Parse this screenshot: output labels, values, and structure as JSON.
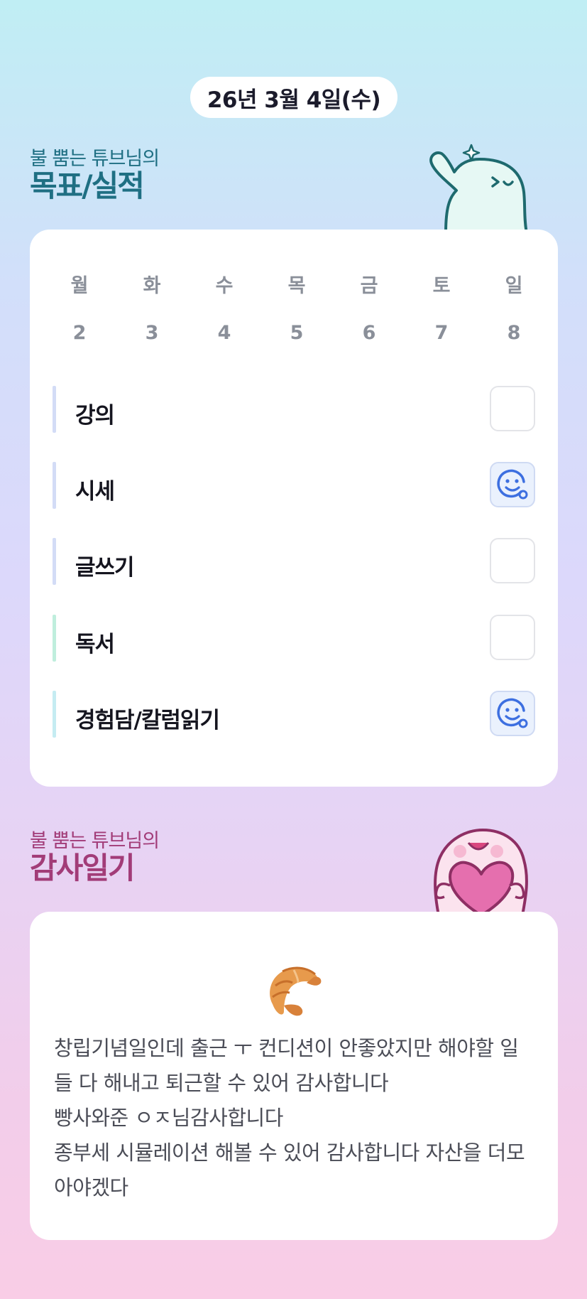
{
  "header": {
    "date": "26년 3월 4일(수)"
  },
  "goals": {
    "subtitle": "불 뿜는 튜브님의",
    "title": "목표/실적",
    "week_days": [
      "월",
      "화",
      "수",
      "목",
      "금",
      "토",
      "일"
    ],
    "week_dates": [
      "2",
      "3",
      "4",
      "5",
      "6",
      "7",
      "8"
    ],
    "items": [
      {
        "label": "강의",
        "done": false,
        "bar_color": "#d3dcf6"
      },
      {
        "label": "시세",
        "done": true,
        "bar_color": "#d3dcf6"
      },
      {
        "label": "글쓰기",
        "done": false,
        "bar_color": "#d3dcf6"
      },
      {
        "label": "독서",
        "done": false,
        "bar_color": "#bfeedd"
      },
      {
        "label": "경험담/칼럼읽기",
        "done": true,
        "bar_color": "#c5ecf2"
      }
    ],
    "done_icon": "smiley-face-icon"
  },
  "gratitude": {
    "subtitle": "불 뿜는 튜브님의",
    "title": "감사일기",
    "emoji": "croissant-icon",
    "text": "창립기념일인데 출근 ㅜ 컨디션이 안좋았지만 해야할 일들 다 해내고 퇴근할 수 있어 감사합니다\n빵사와준 ㅇㅈ님감사합니다\n종부세 시뮬레이션 해볼 수 있어 감사합니다 자산을 더모아야겠다"
  },
  "colors": {
    "goals_title": "#1f6f83",
    "gratitude_title": "#a23c78",
    "done_icon": "#3d6fe0"
  }
}
